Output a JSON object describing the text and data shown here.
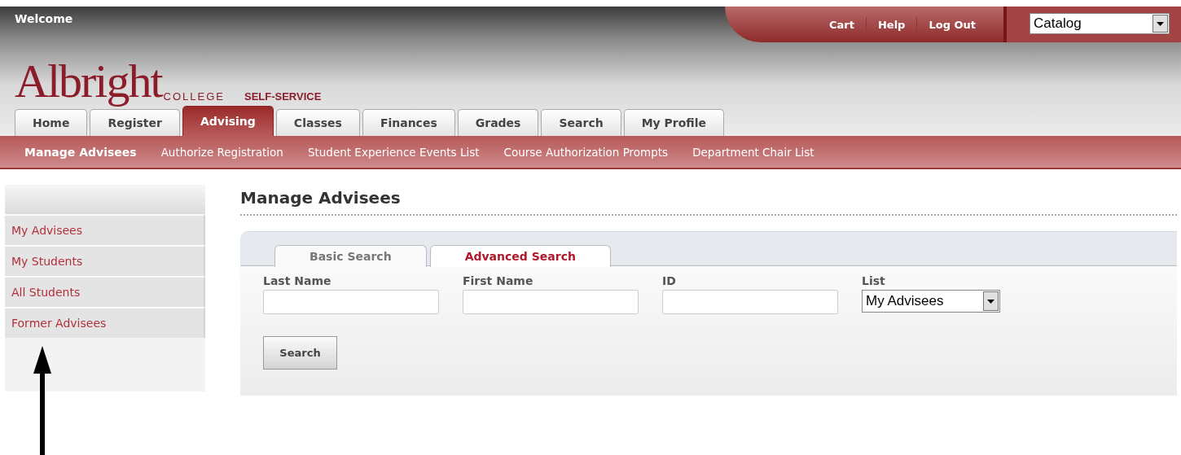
{
  "header": {
    "welcome": "Welcome",
    "logo": {
      "name": "Albright",
      "sub": "COLLEGE",
      "tagline": "SELF-SERVICE"
    },
    "top_links": [
      "Cart",
      "Help",
      "Log Out"
    ],
    "catalog_select": {
      "value": "Catalog"
    }
  },
  "tabs": [
    {
      "label": "Home",
      "selected": false
    },
    {
      "label": "Register",
      "selected": false
    },
    {
      "label": "Advising",
      "selected": true
    },
    {
      "label": "Classes",
      "selected": false
    },
    {
      "label": "Finances",
      "selected": false
    },
    {
      "label": "Grades",
      "selected": false
    },
    {
      "label": "Search",
      "selected": false
    },
    {
      "label": "My Profile",
      "selected": false
    }
  ],
  "subnav": [
    {
      "label": "Manage Advisees",
      "selected": true
    },
    {
      "label": "Authorize Registration",
      "selected": false
    },
    {
      "label": "Student Experience Events List",
      "selected": false
    },
    {
      "label": "Course Authorization Prompts",
      "selected": false
    },
    {
      "label": "Department Chair List",
      "selected": false
    }
  ],
  "sidebar": {
    "items": [
      "My Advisees",
      "My Students",
      "All Students",
      "Former Advisees"
    ]
  },
  "page_title": "Manage Advisees",
  "search_tabs": [
    {
      "label": "Basic Search",
      "selected": true
    },
    {
      "label": "Advanced Search",
      "selected": false
    }
  ],
  "fields": [
    {
      "label": "Last Name",
      "kind": "input"
    },
    {
      "label": "First Name",
      "kind": "input"
    },
    {
      "label": "ID",
      "kind": "input"
    },
    {
      "label": "List",
      "kind": "select",
      "value": "My Advisees"
    }
  ],
  "search_button": "Search"
}
